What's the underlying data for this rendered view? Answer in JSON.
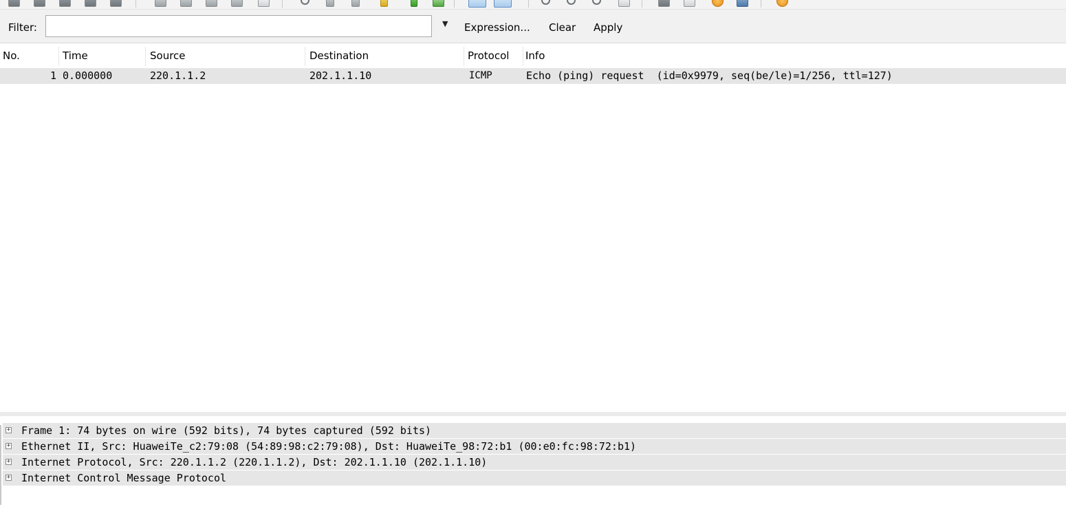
{
  "filter": {
    "label": "Filter:",
    "value": "",
    "expression_label": "Expression...",
    "clear_label": "Clear",
    "apply_label": "Apply"
  },
  "columns": [
    "No.",
    "Time",
    "Source",
    "Destination",
    "Protocol",
    "Info"
  ],
  "packets": [
    {
      "no": "1",
      "time": "0.000000",
      "source": "220.1.1.2",
      "destination": "202.1.1.10",
      "protocol": "ICMP",
      "info": "Echo (ping) request  (id=0x9979, seq(be/le)=1/256, ttl=127)"
    }
  ],
  "details": [
    "Frame 1: 74 bytes on wire (592 bits), 74 bytes captured (592 bits)",
    "Ethernet II, Src: HuaweiTe_c2:79:08 (54:89:98:c2:79:08), Dst: HuaweiTe_98:72:b1 (00:e0:fc:98:72:b1)",
    "Internet Protocol, Src: 220.1.1.2 (220.1.1.2), Dst: 202.1.1.10 (202.1.1.10)",
    "Internet Control Message Protocol"
  ],
  "expander_symbol": "+",
  "dropdown_arrow": "▼",
  "toolbar_icons": [
    "interface-list-icon",
    "capture-options-icon",
    "start-capture-icon",
    "stop-capture-icon",
    "restart-capture-icon",
    "open-file-icon",
    "save-file-icon",
    "close-file-icon",
    "reload-icon",
    "print-icon",
    "find-packet-icon",
    "go-back-icon",
    "go-forward-icon",
    "go-to-packet-icon",
    "go-first-icon",
    "go-last-icon",
    "colorize-icon",
    "auto-scroll-icon",
    "zoom-in-icon",
    "zoom-out-icon",
    "normal-size-icon",
    "resize-columns-icon",
    "capture-filters-icon",
    "display-filters-icon",
    "coloring-rules-icon",
    "preferences-icon",
    "help-icon"
  ]
}
